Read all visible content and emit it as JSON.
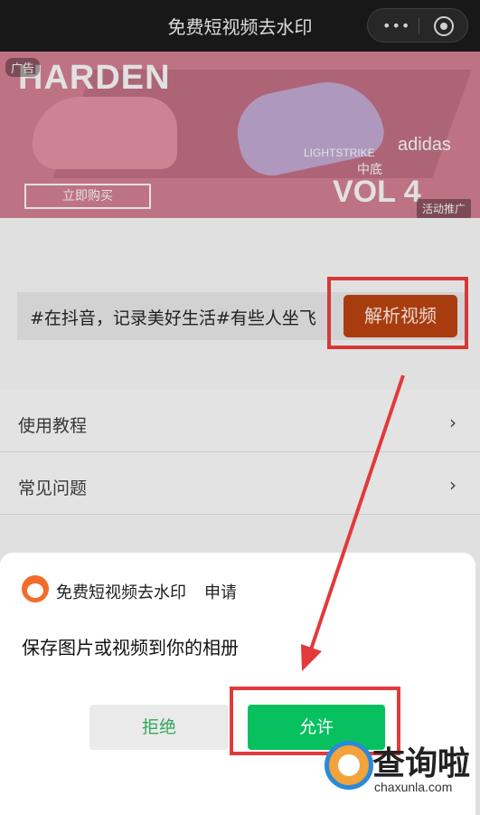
{
  "nav": {
    "title": "免费短视频去水印",
    "more_icon": "more-dots-icon",
    "close_icon": "target-close-icon"
  },
  "banner": {
    "ad_tag": "广告",
    "brand": "HARDEN",
    "buy_label": "立即购买",
    "lightstrike": "LIGHTSTRIKE",
    "sole_label": "中底",
    "adidas": "adidas",
    "volume": "VOL 4",
    "promo_tag": "活动推广"
  },
  "search": {
    "value": "#在抖音，记录美好生活#有些人坐飞",
    "parse_label": "解析视频"
  },
  "menu": {
    "items": [
      {
        "label": "使用教程"
      },
      {
        "label": "常见问题"
      }
    ]
  },
  "dialog": {
    "app_name": "免费短视频去水印",
    "request_word": "申请",
    "permission_text": "保存图片或视频到你的相册",
    "reject_label": "拒绝",
    "allow_label": "允许"
  },
  "watermark": {
    "text": "查询啦",
    "url": "chaxunla.com"
  },
  "colors": {
    "accent_green": "#07c160",
    "parse_button": "#b3400f",
    "highlight_red": "#e23a3a"
  }
}
